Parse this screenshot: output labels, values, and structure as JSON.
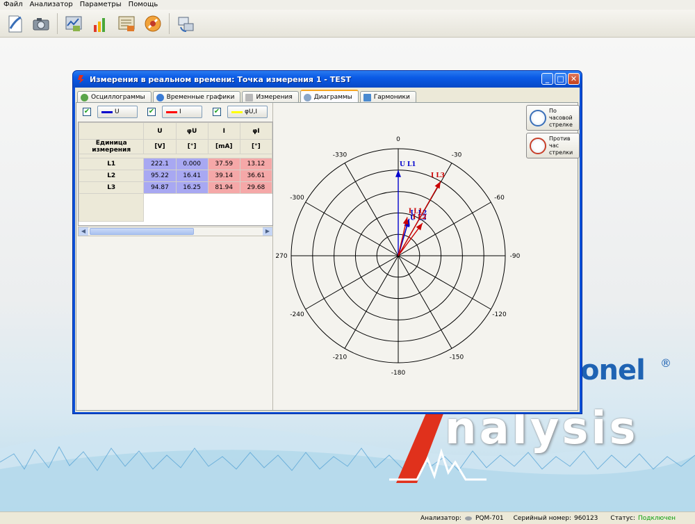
{
  "menu": [
    "Файл",
    "Анализатор",
    "Параметры",
    "Помощь"
  ],
  "toolbar": {
    "buttons": [
      "new-document-icon",
      "camera-icon",
      "analyzer-settings-icon",
      "chart-bars-icon",
      "report-icon",
      "tools-icon",
      "connect-icon"
    ]
  },
  "window": {
    "title": "Измерения в реальном времени: Точка измерения 1 - TEST",
    "minimize": "_",
    "maximize": "□",
    "close": "✕"
  },
  "tabs": [
    {
      "label": "Осциллограммы",
      "icon": "oscilloscope-icon"
    },
    {
      "label": "Временные графики",
      "icon": "time-graph-icon"
    },
    {
      "label": "Измерения",
      "icon": "measurement-table-icon"
    },
    {
      "label": "Диаграммы",
      "icon": "diagram-icon"
    },
    {
      "label": "Гармоники",
      "icon": "harmonics-icon"
    }
  ],
  "series_toggles": [
    {
      "label": "U",
      "checked": "✔",
      "color": "#0000cc"
    },
    {
      "label": "I",
      "checked": "✔",
      "color": "#ff0000"
    },
    {
      "label": "φU,I",
      "checked": "✔",
      "color": "#ffff00"
    }
  ],
  "table": {
    "columns": [
      "U",
      "φU",
      "I",
      "φI"
    ],
    "unit_label": "Единица измерения",
    "units": [
      "[V]",
      "[°]",
      "[mA]",
      "[°]"
    ],
    "rows": [
      {
        "label": "L1",
        "cells": [
          "222.1",
          "0.000",
          "37.59",
          "13.12"
        ]
      },
      {
        "label": "L2",
        "cells": [
          "95.22",
          "16.41",
          "39.14",
          "36.61"
        ]
      },
      {
        "label": "L3",
        "cells": [
          "94.87",
          "16.25",
          "81.94",
          "29.68"
        ]
      }
    ],
    "scroll_left": "◀",
    "scroll_right": "▶"
  },
  "direction_buttons": {
    "clockwise": "По часовой стрелке",
    "counterclockwise": "Против час стрелки"
  },
  "chart_data": {
    "type": "polar",
    "angle_labels": [
      "0",
      "-30",
      "-60",
      "-90",
      "-120",
      "-150",
      "-180",
      "-210",
      "-240",
      "270",
      "-300",
      "-330"
    ],
    "radial_rings": 5,
    "grid": true,
    "series": [
      {
        "name": "U L1",
        "color": "#0000cc",
        "angle_deg": 0,
        "magnitude": 0.8
      },
      {
        "name": "U L2",
        "color": "#0000cc",
        "angle_deg": -16.41,
        "magnitude": 0.36
      },
      {
        "name": "U L3",
        "color": "#0000cc",
        "angle_deg": -16.25,
        "magnitude": 0.35
      },
      {
        "name": "I L1",
        "color": "#cc0000",
        "angle_deg": -13.12,
        "magnitude": 0.37
      },
      {
        "name": "I L2",
        "color": "#cc0000",
        "angle_deg": -36.61,
        "magnitude": 0.38
      },
      {
        "name": "I L3",
        "color": "#cc0000",
        "angle_deg": -29.68,
        "magnitude": 0.8
      }
    ]
  },
  "brand": {
    "company": "onel",
    "registered": "®",
    "product": "nalysis"
  },
  "status": {
    "analyzer_label": "Анализатор:",
    "analyzer_value": "PQM-701",
    "serial_label": "Серийный номер:",
    "serial_value": "960123",
    "status_label": "Статус:",
    "status_value": "Подключен"
  }
}
